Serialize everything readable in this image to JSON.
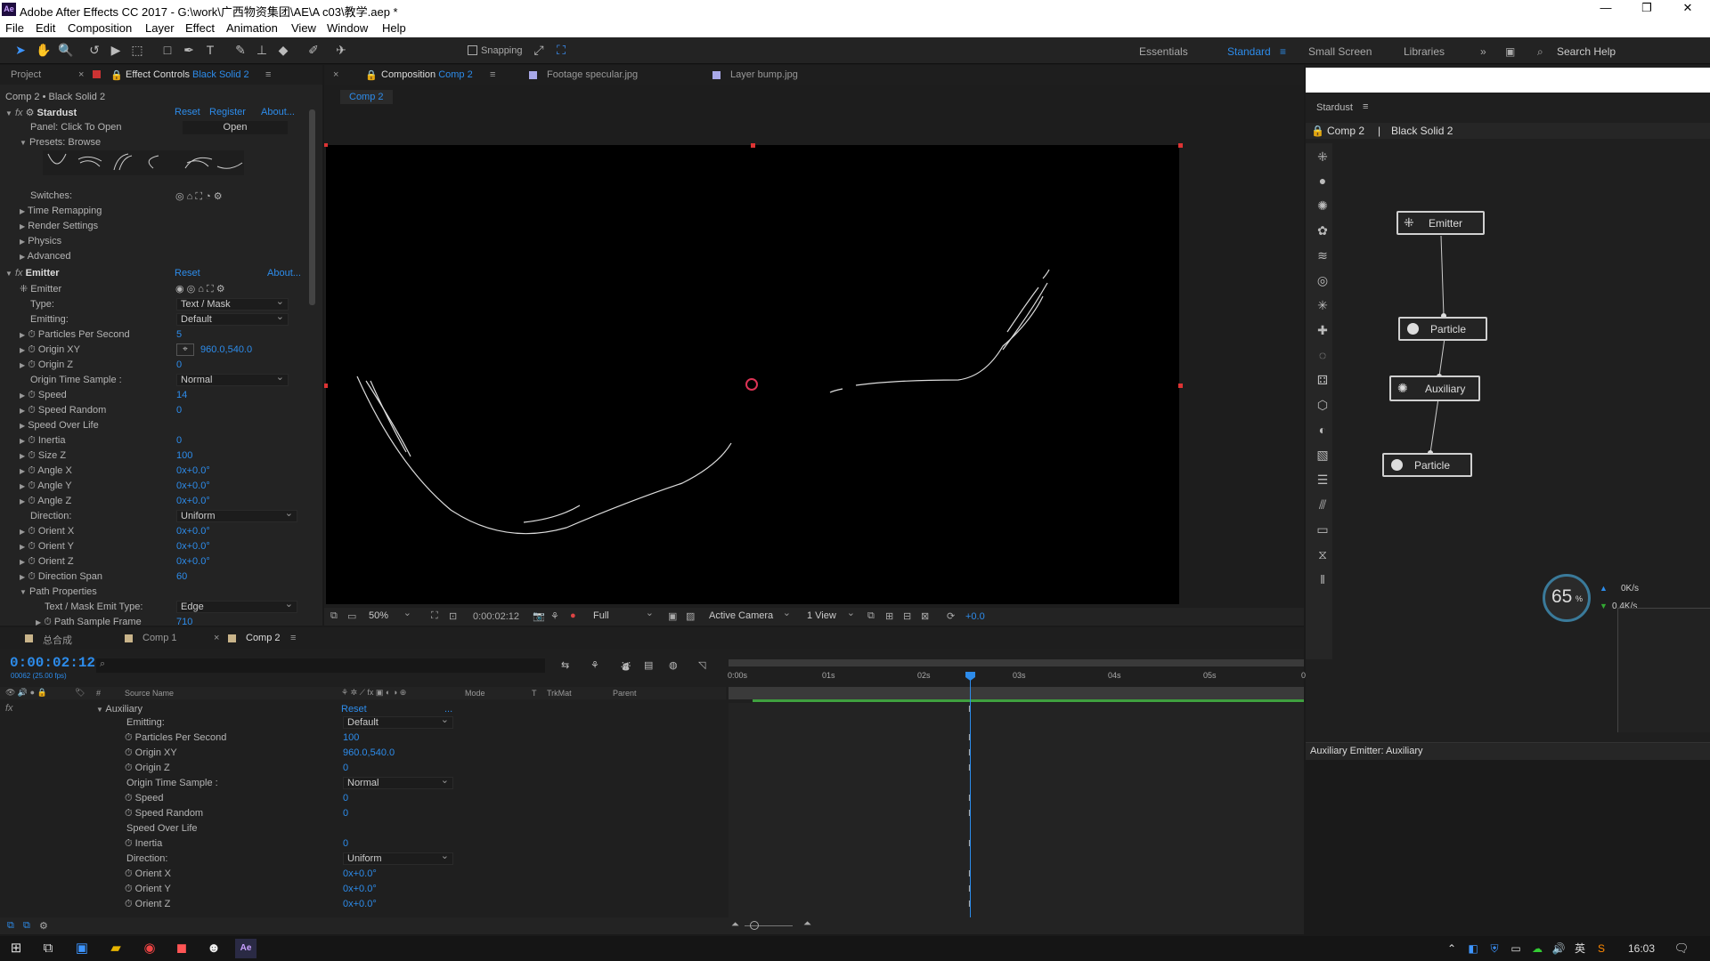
{
  "app": {
    "title": "Adobe After Effects CC 2017 - G:\\work\\广西物资集团\\AE\\A c03\\教学.aep *",
    "icon": "Ae"
  },
  "menu": [
    "File",
    "Edit",
    "Composition",
    "Layer",
    "Effect",
    "Animation",
    "View",
    "Window",
    "Help"
  ],
  "toolbar": {
    "snapping": "Snapping",
    "workspaces": [
      "Essentials",
      "Standard",
      "Small Screen",
      "Libraries"
    ],
    "search": "Search Help"
  },
  "left_panel": {
    "tab_project": "Project",
    "tab_effect": "Effect Controls",
    "tab_effect_layer": "Black Solid 2",
    "breadcrumb": "Comp 2 • Black Solid 2",
    "stardust": {
      "name": "Stardust",
      "reset": "Reset",
      "register": "Register",
      "about": "About...",
      "panel_label": "Panel: Click To Open",
      "open": "Open",
      "presets": "Presets: Browse",
      "switches": "Switches:",
      "groups": [
        "Time Remapping",
        "Render Settings",
        "Physics",
        "Advanced"
      ]
    },
    "emitter": {
      "name": "Emitter",
      "reset": "Reset",
      "about": "About...",
      "sub": "Emitter",
      "rows": [
        {
          "label": "Type:",
          "value": "Text / Mask",
          "kind": "dd"
        },
        {
          "label": "Emitting:",
          "value": "Default",
          "kind": "dd"
        },
        {
          "label": "Particles Per Second",
          "value": "5",
          "kind": "v"
        },
        {
          "label": "Origin XY",
          "value": "960.0,540.0",
          "kind": "v"
        },
        {
          "label": "Origin Z",
          "value": "0",
          "kind": "v"
        },
        {
          "label": "Origin Time Sample :",
          "value": "Normal",
          "kind": "dd"
        },
        {
          "label": "Speed",
          "value": "14",
          "kind": "v"
        },
        {
          "label": "Speed Random",
          "value": "0",
          "kind": "v"
        },
        {
          "label": "Speed Over Life",
          "value": "",
          "kind": "h"
        },
        {
          "label": "Inertia",
          "value": "0",
          "kind": "v"
        },
        {
          "label": "Size Z",
          "value": "100",
          "kind": "v"
        },
        {
          "label": "Angle X",
          "value": "0x+0.0°",
          "kind": "v"
        },
        {
          "label": "Angle Y",
          "value": "0x+0.0°",
          "kind": "v"
        },
        {
          "label": "Angle Z",
          "value": "0x+0.0°",
          "kind": "v"
        },
        {
          "label": "Direction:",
          "value": "Uniform",
          "kind": "dd"
        },
        {
          "label": "Orient X",
          "value": "0x+0.0°",
          "kind": "v"
        },
        {
          "label": "Orient Y",
          "value": "0x+0.0°",
          "kind": "v"
        },
        {
          "label": "Orient Z",
          "value": "0x+0.0°",
          "kind": "v"
        },
        {
          "label": "Direction Span",
          "value": "60",
          "kind": "v"
        },
        {
          "label": "Path Properties",
          "value": "",
          "kind": "h"
        },
        {
          "label": "Text / Mask Emit Type:",
          "value": "Edge",
          "kind": "dd"
        },
        {
          "label": "Path Sample Frame",
          "value": "710",
          "kind": "v"
        }
      ]
    }
  },
  "viewer": {
    "tabs": [
      "Composition",
      "Comp 2",
      "Footage specular.jpg",
      "Layer bump.jpg"
    ],
    "comp_chip": "Comp 2",
    "footer": {
      "zoom": "50%",
      "time": "0:00:02:12",
      "quality": "Full",
      "camera": "Active Camera",
      "views": "1 View",
      "exposure": "+0.0"
    }
  },
  "stardust_panel": {
    "title": "Stardust",
    "crumb_comp": "Comp 2",
    "crumb_sep": "|",
    "crumb_layer": "Black Solid 2",
    "nodes": [
      "Emitter",
      "Particle",
      "Auxiliary",
      "Particle"
    ],
    "status": "Auxiliary Emitter: Auxiliary",
    "perf": {
      "pct": "65",
      "unit": "%",
      "up": "0K/s",
      "down": "0.4K/s"
    }
  },
  "timeline": {
    "tabs": [
      "总合成",
      "Comp 1",
      "Comp 2"
    ],
    "time": "0:00:02:12",
    "fps": "00062 (25.00 fps)",
    "cols": [
      "#",
      "Source Name",
      "Mode",
      "T",
      "TrkMat",
      "Parent"
    ],
    "ruler": [
      "0:00s",
      "01s",
      "02s",
      "03s",
      "04s",
      "05s",
      "0"
    ],
    "layer": "Auxiliary",
    "reset": "Reset",
    "dots": "...",
    "rows": [
      {
        "label": "Emitting:",
        "value": "Default",
        "kind": "dd",
        "icon": false
      },
      {
        "label": "Particles Per Second",
        "value": "100",
        "kind": "v",
        "icon": true
      },
      {
        "label": "Origin XY",
        "value": "960.0,540.0",
        "kind": "v",
        "icon": true
      },
      {
        "label": "Origin Z",
        "value": "0",
        "kind": "v",
        "icon": true
      },
      {
        "label": "Origin Time Sample :",
        "value": "Normal",
        "kind": "dd",
        "icon": false
      },
      {
        "label": "Speed",
        "value": "0",
        "kind": "v",
        "icon": true
      },
      {
        "label": "Speed Random",
        "value": "0",
        "kind": "v",
        "icon": true
      },
      {
        "label": "Speed Over Life",
        "value": "",
        "kind": "h",
        "icon": false
      },
      {
        "label": "Inertia",
        "value": "0",
        "kind": "v",
        "icon": true
      },
      {
        "label": "Direction:",
        "value": "Uniform",
        "kind": "dd",
        "icon": false
      },
      {
        "label": "Orient X",
        "value": "0x+0.0°",
        "kind": "v",
        "icon": true
      },
      {
        "label": "Orient Y",
        "value": "0x+0.0°",
        "kind": "v",
        "icon": true
      },
      {
        "label": "Orient Z",
        "value": "0x+0.0°",
        "kind": "v",
        "icon": true
      }
    ]
  },
  "taskbar": {
    "time": "16:03",
    "ime": "英"
  }
}
